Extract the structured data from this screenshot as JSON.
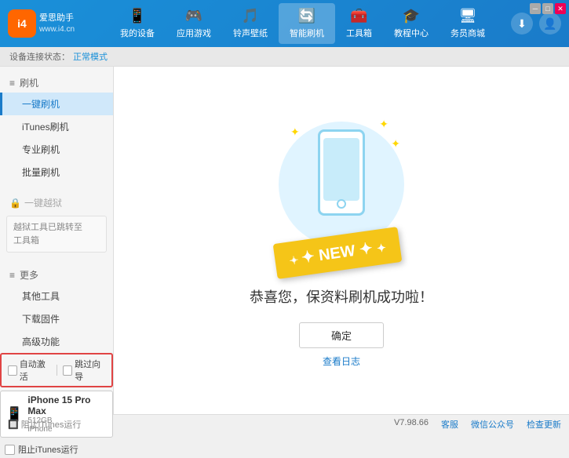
{
  "app": {
    "title": "爱思助手",
    "subtitle": "www.i4.cn"
  },
  "window_controls": {
    "min": "─",
    "max": "□",
    "close": "✕"
  },
  "nav": {
    "items": [
      {
        "id": "my-device",
        "icon": "📱",
        "label": "我的设备"
      },
      {
        "id": "apps-games",
        "icon": "🎮",
        "label": "应用游戏"
      },
      {
        "id": "ringtone",
        "icon": "🎵",
        "label": "铃声壁纸"
      },
      {
        "id": "smart-flash",
        "icon": "🔄",
        "label": "智能刷机",
        "active": true
      },
      {
        "id": "toolbox",
        "icon": "🧰",
        "label": "工具箱"
      },
      {
        "id": "tutorial",
        "icon": "🎓",
        "label": "教程中心"
      },
      {
        "id": "service",
        "icon": "🖥",
        "label": "务员商城"
      }
    ]
  },
  "header_right": {
    "download_icon": "⬇",
    "user_icon": "👤"
  },
  "breadcrumb": {
    "prefix": "设备连接状态：",
    "status": "正常模式"
  },
  "sidebar": {
    "section_flash": "刷机",
    "items": [
      {
        "id": "one-key-flash",
        "label": "一键刷机",
        "active": true
      },
      {
        "id": "itunes-flash",
        "label": "iTunes刷机"
      },
      {
        "id": "pro-flash",
        "label": "专业刷机"
      },
      {
        "id": "batch-flash",
        "label": "批量刷机"
      }
    ],
    "section_more": "更多",
    "disabled_label": "一键越狱",
    "info_text": "越狱工具已跳转至\n工具箱",
    "more_items": [
      {
        "id": "other-tools",
        "label": "其他工具"
      },
      {
        "id": "download-firmware",
        "label": "下载固件"
      },
      {
        "id": "advanced",
        "label": "高级功能"
      }
    ]
  },
  "content": {
    "new_badge": "NEW",
    "success_message": "恭喜您，保资料刷机成功啦！",
    "confirm_button": "确定",
    "log_link": "查看日志"
  },
  "status_bar": {
    "version": "V7.98.66",
    "items": [
      {
        "id": "home",
        "label": "客服"
      },
      {
        "id": "wechat",
        "label": "微信公众号"
      },
      {
        "id": "check-update",
        "label": "检查更新"
      }
    ]
  },
  "device": {
    "checkbox_auto": "自动激活",
    "checkbox_guide": "跳过向导",
    "name": "iPhone 15 Pro Max",
    "storage": "512GB",
    "type": "iPhone",
    "icon": "📱"
  },
  "itunes": {
    "label": "阻止iTunes运行",
    "icon": "▣"
  }
}
